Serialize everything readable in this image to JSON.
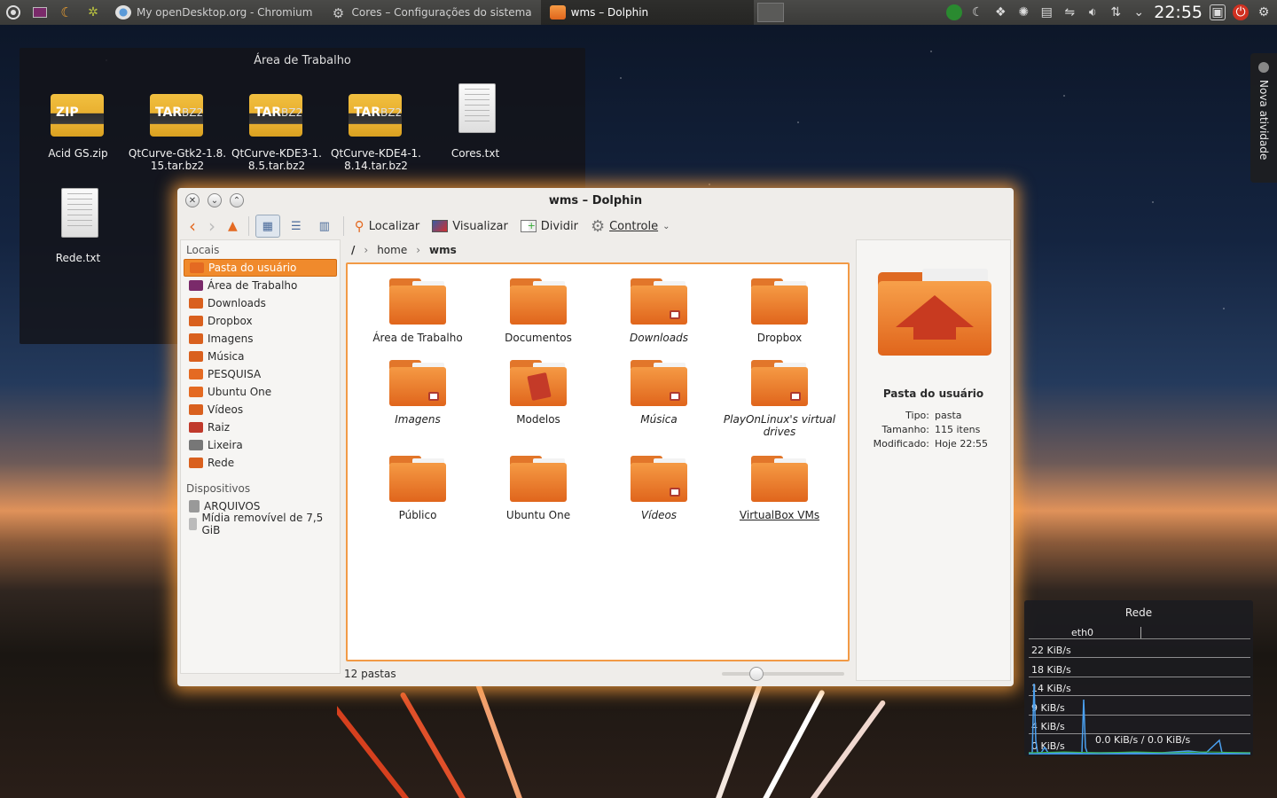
{
  "panel": {
    "tasks": [
      {
        "label": "My openDesktop.org - Chromium",
        "active": false
      },
      {
        "label": "Cores – Configurações do sistema",
        "active": false
      },
      {
        "label": "wms – Dolphin",
        "active": true
      }
    ],
    "clock": "22:55"
  },
  "desktop": {
    "title": "Área de Trabalho",
    "files": [
      {
        "name": "Acid GS.zip",
        "kind": "zip",
        "badge": "ZIP"
      },
      {
        "name": "QtCurve-Gtk2-1.8.15.tar.bz2",
        "kind": "tar",
        "badge": "TAR",
        "badge2": "BZ2"
      },
      {
        "name": "QtCurve-KDE3-1.8.5.tar.bz2",
        "kind": "tar",
        "badge": "TAR",
        "badge2": "BZ2"
      },
      {
        "name": "QtCurve-KDE4-1.8.14.tar.bz2",
        "kind": "tar",
        "badge": "TAR",
        "badge2": "BZ2"
      },
      {
        "name": "Cores.txt",
        "kind": "txt"
      },
      {
        "name": "Rede.txt",
        "kind": "txt"
      }
    ],
    "activity": "Nova atividade"
  },
  "window": {
    "title": "wms – Dolphin",
    "toolbar": {
      "find": "Localizar",
      "preview": "Visualizar",
      "split": "Dividir",
      "control": "Controle"
    },
    "places": {
      "group1": "Locais",
      "items": [
        {
          "label": "Pasta do usuário",
          "color": "#e46a22"
        },
        {
          "label": "Área de Trabalho",
          "color": "#7a2a6a"
        },
        {
          "label": "Downloads",
          "color": "#d9601e"
        },
        {
          "label": "Dropbox",
          "color": "#d9601e"
        },
        {
          "label": "Imagens",
          "color": "#d9601e"
        },
        {
          "label": "Música",
          "color": "#d9601e"
        },
        {
          "label": "PESQUISA",
          "color": "#e46a22"
        },
        {
          "label": "Ubuntu One",
          "color": "#e46a22"
        },
        {
          "label": "Vídeos",
          "color": "#d9601e"
        },
        {
          "label": "Raiz",
          "color": "#c0392b"
        },
        {
          "label": "Lixeira",
          "color": "#777777"
        },
        {
          "label": "Rede",
          "color": "#d9601e"
        }
      ],
      "group2": "Dispositivos",
      "devices": [
        {
          "label": "ARQUIVOS"
        },
        {
          "label": "Mídia removível de 7,5 GiB"
        }
      ]
    },
    "breadcrumb": {
      "root": "/",
      "parts": [
        "home",
        "wms"
      ]
    },
    "folders": [
      {
        "name": "Área de Trabalho",
        "italic": false,
        "emblem": false
      },
      {
        "name": "Documentos",
        "italic": false,
        "emblem": false
      },
      {
        "name": "Downloads",
        "italic": true,
        "emblem": true
      },
      {
        "name": "Dropbox",
        "italic": false,
        "emblem": false
      },
      {
        "name": "Imagens",
        "italic": true,
        "emblem": true
      },
      {
        "name": "Modelos",
        "italic": false,
        "emblem": false,
        "template": true
      },
      {
        "name": "Música",
        "italic": true,
        "emblem": true
      },
      {
        "name": "PlayOnLinux's virtual drives",
        "italic": true,
        "emblem": true
      },
      {
        "name": "Público",
        "italic": false,
        "emblem": false
      },
      {
        "name": "Ubuntu One",
        "italic": false,
        "emblem": false
      },
      {
        "name": "Vídeos",
        "italic": true,
        "emblem": true
      },
      {
        "name": "VirtualBox VMs",
        "italic": false,
        "emblem": false
      }
    ],
    "status": "12 pastas",
    "zoom_level": 0.25,
    "info": {
      "name": "Pasta do usuário",
      "rows": [
        {
          "k": "Tipo:",
          "v": "pasta"
        },
        {
          "k": "Tamanho:",
          "v": "115 itens"
        },
        {
          "k": "Modificado:",
          "v": "Hoje 22:55"
        }
      ]
    }
  },
  "network": {
    "title": "Rede",
    "iface": "eth0",
    "ticks": [
      "22 KiB/s",
      "18 KiB/s",
      "14 KiB/s",
      "9 KiB/s",
      "4 KiB/s",
      "0 KiB/s"
    ],
    "rate": "0.0 KiB/s / 0.0 KiB/s"
  }
}
